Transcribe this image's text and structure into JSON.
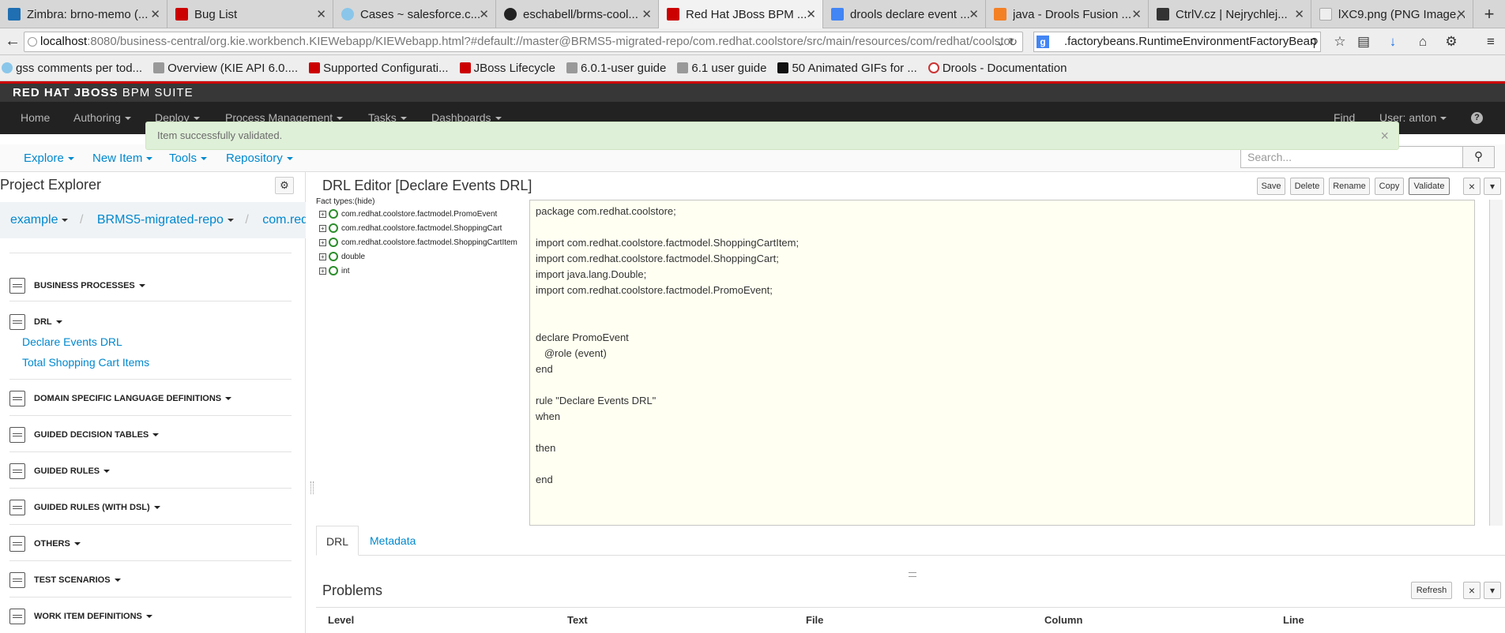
{
  "browser": {
    "tabs": [
      {
        "title": "Zimbra: brno-memo (...",
        "icon_color": "#1f6fb2",
        "active": false
      },
      {
        "title": "Bug List",
        "icon_color": "#cc0000",
        "active": false
      },
      {
        "title": "Cases ~ salesforce.c...",
        "icon_color": "#8ac6ea",
        "active": false
      },
      {
        "title": "eschabell/brms-cool...",
        "icon_color": "#222222",
        "active": false
      },
      {
        "title": "Red Hat JBoss BPM ...",
        "icon_color": "#cc0000",
        "active": true
      },
      {
        "title": "drools declare event ...",
        "icon_color": "#4285f4",
        "active": false
      },
      {
        "title": "java - Drools Fusion ...",
        "icon_color": "#f48024",
        "active": false
      },
      {
        "title": "CtrlV.cz | Nejrychlej...",
        "icon_color": "#333333",
        "active": false
      },
      {
        "title": "lXC9.png (PNG Image, ...",
        "icon_color": "#cccccc",
        "active": false
      }
    ],
    "new_tab": "+",
    "url_host": "localhost",
    "url_rest": ":8080/business-central/org.kie.workbench.KIEWebapp/KIEWebapp.html?#default://master@BRMS5-migrated-repo/com.redhat.coolstore/src/main/resources/com/redhat/coolstor",
    "search_text": ".factorybeans.RuntimeEnvironmentFactoryBean",
    "bookmarks": [
      "gss comments per tod...",
      "Overview (KIE API 6.0....",
      "Supported Configurati...",
      "JBoss Lifecycle",
      "6.0.1-user guide",
      "6.1 user guide",
      "50 Animated GIFs for ...",
      "Drools - Documentation"
    ]
  },
  "app": {
    "brand_bold": "RED HAT JBOSS",
    "brand_rest": " BPM SUITE",
    "menu": {
      "home": "Home",
      "authoring": "Authoring",
      "deploy": "Deploy",
      "process_management": "Process Management",
      "tasks": "Tasks",
      "dashboards": "Dashboards",
      "find": "Find",
      "user": "User: anton"
    },
    "alert": "Item successfully validated.",
    "subbar": {
      "explore": "Explore",
      "new_item": "New Item",
      "tools": "Tools",
      "repository": "Repository",
      "search_placeholder": "Search..."
    },
    "explorer": {
      "title": "Project Explorer",
      "breadcrumb": [
        "example",
        "BRMS5-migrated-repo",
        "com.redhat.co"
      ],
      "sections": [
        "BUSINESS PROCESSES",
        "DRL",
        "DOMAIN SPECIFIC LANGUAGE DEFINITIONS",
        "GUIDED DECISION TABLES",
        "GUIDED RULES",
        "GUIDED RULES (WITH DSL)",
        "OTHERS",
        "TEST SCENARIOS",
        "WORK ITEM DEFINITIONS"
      ],
      "drl_items": [
        "Declare Events DRL",
        "Total Shopping Cart Items"
      ]
    },
    "editor": {
      "title": "DRL Editor [Declare Events DRL]",
      "buttons": {
        "save": "Save",
        "delete": "Delete",
        "rename": "Rename",
        "copy": "Copy",
        "validate": "Validate",
        "close": "×",
        "menu": "▾"
      },
      "fact_types_header": "Fact types:(hide)",
      "fact_types": [
        "com.redhat.coolstore.factmodel.PromoEvent",
        "com.redhat.coolstore.factmodel.ShoppingCart",
        "com.redhat.coolstore.factmodel.ShoppingCartItem",
        "double",
        "int"
      ],
      "code_lines": [
        "package com.redhat.coolstore;",
        "",
        "import com.redhat.coolstore.factmodel.ShoppingCartItem;",
        "import com.redhat.coolstore.factmodel.ShoppingCart;",
        "import java.lang.Double;",
        "import com.redhat.coolstore.factmodel.PromoEvent;",
        "",
        "",
        "declare PromoEvent",
        "   @role (event)",
        "end",
        "",
        "rule \"Declare Events DRL\"",
        "when",
        "",
        "then",
        "",
        "end"
      ],
      "tabs": {
        "drl": "DRL",
        "metadata": "Metadata"
      }
    },
    "problems": {
      "title": "Problems",
      "refresh": "Refresh",
      "columns": {
        "level": "Level",
        "text": "Text",
        "file": "File",
        "column": "Column",
        "line": "Line"
      }
    }
  }
}
